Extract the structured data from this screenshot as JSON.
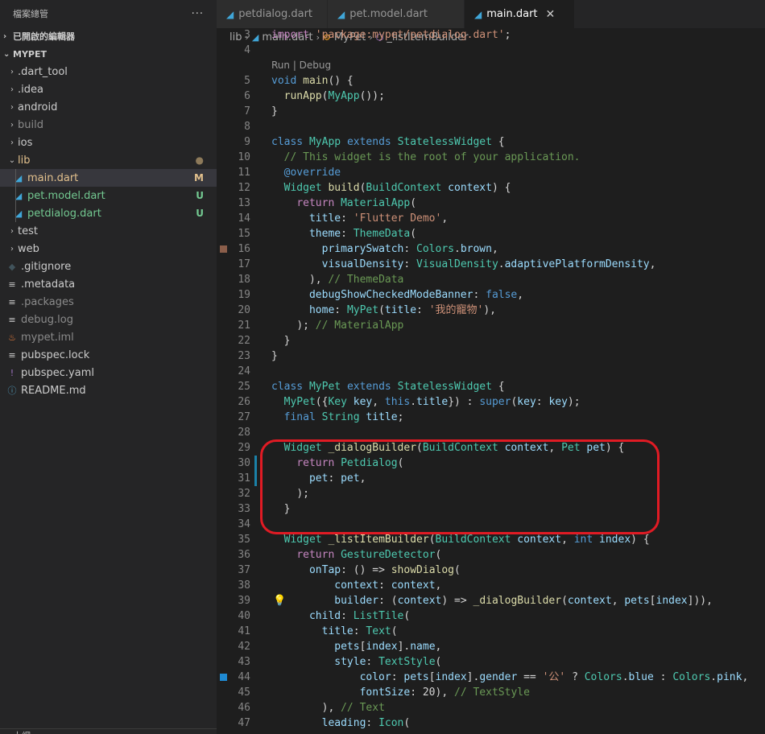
{
  "sidebar": {
    "title": "檔案總管",
    "more_label": "···",
    "open_editors_label": "已開啟的編輯器",
    "project_label": "MYPET",
    "items": [
      {
        "label": ".dart_tool",
        "kind": "folder",
        "expanded": false,
        "color": "#cccccc"
      },
      {
        "label": ".idea",
        "kind": "folder",
        "expanded": false,
        "color": "#cccccc"
      },
      {
        "label": "android",
        "kind": "folder",
        "expanded": false,
        "color": "#cccccc"
      },
      {
        "label": "build",
        "kind": "folder",
        "expanded": false,
        "color": "#8b8b8b"
      },
      {
        "label": "ios",
        "kind": "folder",
        "expanded": false,
        "color": "#cccccc"
      },
      {
        "label": "lib",
        "kind": "folder",
        "expanded": true,
        "color": "#e2c08d",
        "badge": "●",
        "badge_color": "#8d7a5a"
      },
      {
        "label": "main.dart",
        "kind": "dart",
        "color": "#e2c08d",
        "badge": "M",
        "badge_color": "#e2c08d",
        "selected": true
      },
      {
        "label": "pet.model.dart",
        "kind": "dart",
        "color": "#73c991",
        "badge": "U",
        "badge_color": "#73c991"
      },
      {
        "label": "petdialog.dart",
        "kind": "dart",
        "color": "#73c991",
        "badge": "U",
        "badge_color": "#73c991"
      },
      {
        "label": "test",
        "kind": "folder",
        "expanded": false,
        "color": "#cccccc"
      },
      {
        "label": "web",
        "kind": "folder",
        "expanded": false,
        "color": "#cccccc"
      },
      {
        "label": ".gitignore",
        "kind": "git",
        "color": "#cccccc"
      },
      {
        "label": ".metadata",
        "kind": "lines",
        "color": "#cccccc"
      },
      {
        "label": ".packages",
        "kind": "lines",
        "color": "#8b8b8b"
      },
      {
        "label": "debug.log",
        "kind": "lines",
        "color": "#8b8b8b"
      },
      {
        "label": "mypet.iml",
        "kind": "rss",
        "color": "#8b8b8b"
      },
      {
        "label": "pubspec.lock",
        "kind": "lines",
        "color": "#cccccc"
      },
      {
        "label": "pubspec.yaml",
        "kind": "yaml",
        "color": "#cccccc"
      },
      {
        "label": "README.md",
        "kind": "info",
        "color": "#cccccc"
      }
    ],
    "bottom_label": "大綱"
  },
  "tabs": [
    {
      "label": "petdialog.dart",
      "active": false
    },
    {
      "label": "pet.model.dart",
      "active": false
    },
    {
      "label": "main.dart",
      "active": true,
      "close": "✕"
    }
  ],
  "breadcrumb": [
    "lib",
    "main.dart",
    "MyPet",
    "_listItemBuilder"
  ],
  "codelens": "Run | Debug",
  "lines": [
    {
      "n": "3",
      "html": "<span class=\"c\">import</span> <span class=\"s\">'package:mypet/petdialog.dart'</span><span class=\"p\">;</span>"
    },
    {
      "n": "4",
      "html": ""
    },
    {
      "lens": true
    },
    {
      "n": "5",
      "html": "<span class=\"k\">void</span> <span class=\"f\">main</span><span class=\"p\">() {</span>"
    },
    {
      "n": "6",
      "html": "  <span class=\"f\">runApp</span><span class=\"p\">(</span><span class=\"t\">MyApp</span><span class=\"p\">());</span>"
    },
    {
      "n": "7",
      "html": "<span class=\"p\">}</span>"
    },
    {
      "n": "8",
      "html": ""
    },
    {
      "n": "9",
      "html": "<span class=\"k\">class</span> <span class=\"t\">MyApp</span> <span class=\"k\">extends</span> <span class=\"t\">StatelessWidget</span> <span class=\"p\">{</span>"
    },
    {
      "n": "10",
      "html": "  <span class=\"cm\">// This widget is the root of your application.</span>"
    },
    {
      "n": "11",
      "html": "  <span class=\"k\">@override</span>"
    },
    {
      "n": "12",
      "html": "  <span class=\"t\">Widget</span> <span class=\"f\">build</span><span class=\"p\">(</span><span class=\"t\">BuildContext</span> <span class=\"v\">context</span><span class=\"p\">) {</span>"
    },
    {
      "n": "13",
      "html": "    <span class=\"c\">return</span> <span class=\"t\">MaterialApp</span><span class=\"p\">(</span>"
    },
    {
      "n": "14",
      "html": "      <span class=\"v\">title</span><span class=\"p\">: </span><span class=\"s\">'Flutter Demo'</span><span class=\"p\">,</span>"
    },
    {
      "n": "15",
      "html": "      <span class=\"v\">theme</span><span class=\"p\">: </span><span class=\"t\">ThemeData</span><span class=\"p\">(</span>"
    },
    {
      "n": "16",
      "html": "        <span class=\"v\">primarySwatch</span><span class=\"p\">: </span><span class=\"t\">Colors</span><span class=\"p\">.</span><span class=\"v\">brown</span><span class=\"p\">,</span>",
      "mark": "#8b5e4a"
    },
    {
      "n": "17",
      "html": "        <span class=\"v\">visualDensity</span><span class=\"p\">: </span><span class=\"t\">VisualDensity</span><span class=\"p\">.</span><span class=\"v\">adaptivePlatformDensity</span><span class=\"p\">,</span>"
    },
    {
      "n": "18",
      "html": "      <span class=\"p\">), </span><span class=\"cm\">// ThemeData</span>"
    },
    {
      "n": "19",
      "html": "      <span class=\"v\">debugShowCheckedModeBanner</span><span class=\"p\">: </span><span class=\"k\">false</span><span class=\"p\">,</span>"
    },
    {
      "n": "20",
      "html": "      <span class=\"v\">home</span><span class=\"p\">: </span><span class=\"t\">MyPet</span><span class=\"p\">(</span><span class=\"v\">title</span><span class=\"p\">: </span><span class=\"s\">'我的寵物'</span><span class=\"p\">),</span>"
    },
    {
      "n": "21",
      "html": "    <span class=\"p\">); </span><span class=\"cm\">// MaterialApp</span>"
    },
    {
      "n": "22",
      "html": "  <span class=\"p\">}</span>"
    },
    {
      "n": "23",
      "html": "<span class=\"p\">}</span>"
    },
    {
      "n": "24",
      "html": ""
    },
    {
      "n": "25",
      "html": "<span class=\"k\">class</span> <span class=\"t\">MyPet</span> <span class=\"k\">extends</span> <span class=\"t\">StatelessWidget</span> <span class=\"p\">{</span>"
    },
    {
      "n": "26",
      "html": "  <span class=\"t\">MyPet</span><span class=\"p\">({</span><span class=\"t\">Key</span> <span class=\"v\">key</span><span class=\"p\">, </span><span class=\"k\">this</span><span class=\"p\">.</span><span class=\"v\">title</span><span class=\"p\">}) : </span><span class=\"k\">super</span><span class=\"p\">(</span><span class=\"v\">key</span><span class=\"p\">: </span><span class=\"v\">key</span><span class=\"p\">);</span>"
    },
    {
      "n": "27",
      "html": "  <span class=\"k\">final</span> <span class=\"t\">String</span> <span class=\"v\">title</span><span class=\"p\">;</span>"
    },
    {
      "n": "28",
      "html": ""
    },
    {
      "n": "29",
      "html": "  <span class=\"t\">Widget</span> <span class=\"f\">_dialogBuilder</span><span class=\"p\">(</span><span class=\"t\">BuildContext</span> <span class=\"v\">context</span><span class=\"p\">, </span><span class=\"t\">Pet</span> <span class=\"v\">pet</span><span class=\"p\">) {</span>"
    },
    {
      "n": "30",
      "html": "    <span class=\"c\">return</span> <span class=\"t\">Petdialog</span><span class=\"p\">(</span>",
      "change": true
    },
    {
      "n": "31",
      "html": "      <span class=\"v\">pet</span><span class=\"p\">: </span><span class=\"v\">pet</span><span class=\"p\">,</span>",
      "change": true
    },
    {
      "n": "32",
      "html": "    <span class=\"p\">);</span>"
    },
    {
      "n": "33",
      "html": "  <span class=\"p\">}</span>"
    },
    {
      "n": "34",
      "html": ""
    },
    {
      "n": "35",
      "html": "  <span class=\"t\">Widget</span> <span class=\"f\">_listItemBuilder</span><span class=\"p\">(</span><span class=\"t\">BuildContext</span> <span class=\"v\">context</span><span class=\"p\">, </span><span class=\"k\">int</span> <span class=\"v\">index</span><span class=\"p\">) {</span>"
    },
    {
      "n": "36",
      "html": "    <span class=\"c\">return</span> <span class=\"t\">GestureDetector</span><span class=\"p\">(</span>"
    },
    {
      "n": "37",
      "html": "      <span class=\"v\">onTap</span><span class=\"p\">: () => </span><span class=\"f\">showDialog</span><span class=\"p\">(</span>"
    },
    {
      "n": "38",
      "html": "          <span class=\"v\">context</span><span class=\"p\">: </span><span class=\"v\">context</span><span class=\"p\">,</span>"
    },
    {
      "n": "39",
      "html": "          <span class=\"v\">builder</span><span class=\"p\">: (</span><span class=\"v\">context</span><span class=\"p\">) => </span><span class=\"f\">_dialogBuilder</span><span class=\"p\">(</span><span class=\"v\">context</span><span class=\"p\">, </span><span class=\"v\">pets</span><span class=\"p\">[</span><span class=\"v\">index</span><span class=\"p\">])),</span>",
      "bulb": true
    },
    {
      "n": "40",
      "html": "      <span class=\"v\">child</span><span class=\"p\">: </span><span class=\"t\">ListTile</span><span class=\"p\">(</span>"
    },
    {
      "n": "41",
      "html": "        <span class=\"v\">title</span><span class=\"p\">: </span><span class=\"t\">Text</span><span class=\"p\">(</span>"
    },
    {
      "n": "42",
      "html": "          <span class=\"v\">pets</span><span class=\"p\">[</span><span class=\"v\">index</span><span class=\"p\">].</span><span class=\"v\">name</span><span class=\"p\">,</span>"
    },
    {
      "n": "43",
      "html": "          <span class=\"v\">style</span><span class=\"p\">: </span><span class=\"t\">TextStyle</span><span class=\"p\">(</span>"
    },
    {
      "n": "44",
      "html": "              <span class=\"v\">color</span><span class=\"p\">: </span><span class=\"v\">pets</span><span class=\"p\">[</span><span class=\"v\">index</span><span class=\"p\">].</span><span class=\"v\">gender</span><span class=\"p\"> == </span><span class=\"s\">'公'</span><span class=\"p\"> ? </span><span class=\"t\">Colors</span><span class=\"p\">.</span><span class=\"v\">blue</span><span class=\"p\"> : </span><span class=\"t\">Colors</span><span class=\"p\">.</span><span class=\"v\">pink</span><span class=\"p\">,</span>",
      "mark": "#1f8ad2"
    },
    {
      "n": "45",
      "html": "              <span class=\"v\">fontSize</span><span class=\"p\">: 20), </span><span class=\"cm\">// TextStyle</span>"
    },
    {
      "n": "46",
      "html": "        <span class=\"p\">), </span><span class=\"cm\">// Text</span>"
    },
    {
      "n": "47",
      "html": "        <span class=\"v\">leading</span><span class=\"p\">: </span><span class=\"t\">Icon</span><span class=\"p\">(</span>"
    }
  ]
}
